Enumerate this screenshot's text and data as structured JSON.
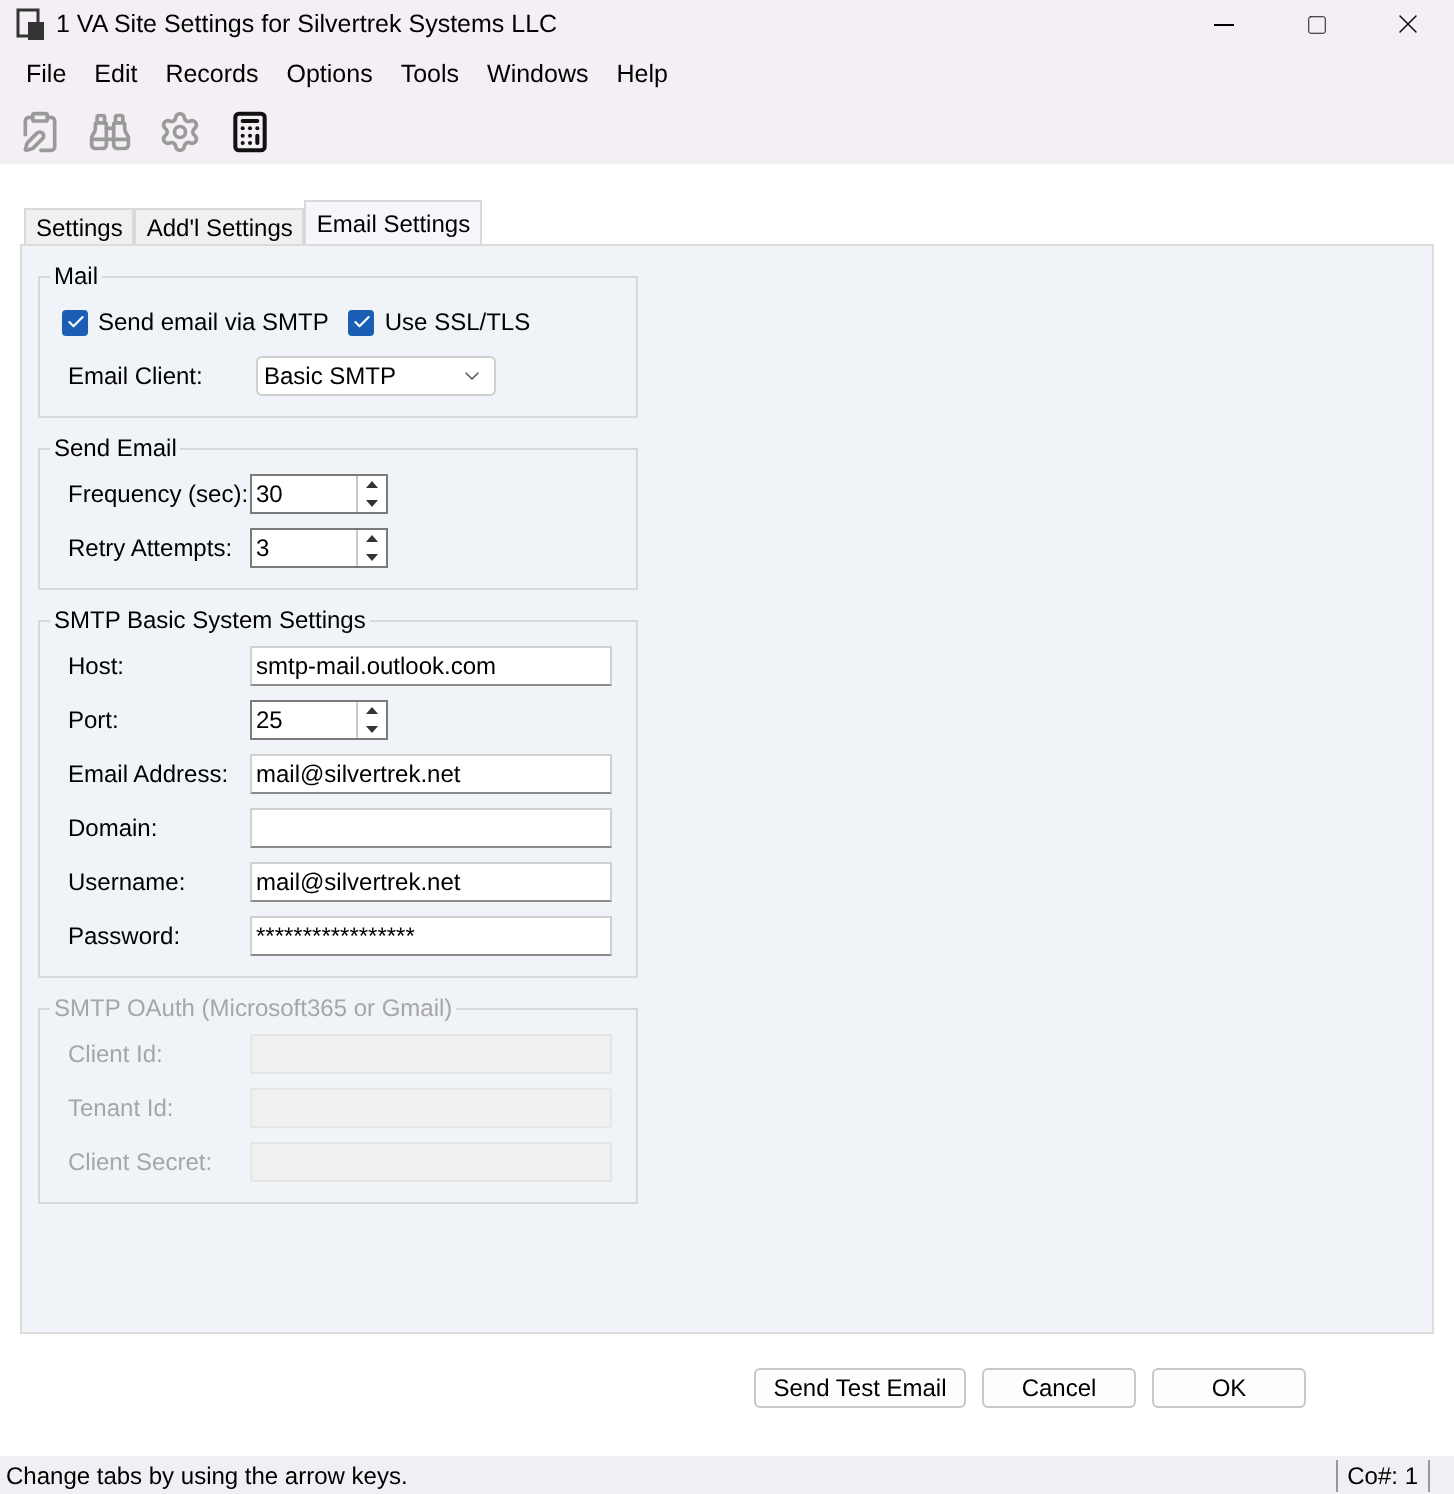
{
  "window": {
    "title": "1 VA Site Settings for Silvertrek Systems LLC"
  },
  "menu": [
    "File",
    "Edit",
    "Records",
    "Options",
    "Tools",
    "Windows",
    "Help"
  ],
  "toolbar": [
    {
      "kind": "clipboard",
      "disabled": true
    },
    {
      "kind": "binoculars",
      "disabled": true
    },
    {
      "kind": "gear",
      "disabled": true
    },
    {
      "kind": "calculator",
      "disabled": false
    }
  ],
  "tabs": [
    {
      "label": "Settings",
      "selected": false
    },
    {
      "label": "Add'l Settings",
      "selected": false
    },
    {
      "label": "Email Settings",
      "selected": true
    }
  ],
  "groups": [
    {
      "title": "Mail",
      "disabled": false,
      "checkboxes": [
        {
          "label": "Send email via SMTP",
          "checked": true
        },
        {
          "label": "Use SSL/TLS",
          "checked": true
        }
      ],
      "fields": [
        {
          "label": "Email Client:",
          "kind": "select",
          "value": "Basic SMTP"
        }
      ]
    },
    {
      "title": "Send Email",
      "disabled": false,
      "fields": [
        {
          "label": "Frequency (sec):",
          "kind": "spin",
          "value": "30"
        },
        {
          "label": "Retry Attempts:",
          "kind": "spin",
          "value": "3"
        }
      ]
    },
    {
      "title": "SMTP Basic System Settings",
      "disabled": false,
      "fields": [
        {
          "label": "Host:",
          "kind": "text",
          "value": "smtp-mail.outlook.com"
        },
        {
          "label": "Port:",
          "kind": "spin",
          "value": "25"
        },
        {
          "label": "Email Address:",
          "kind": "text",
          "value": "mail@silvertrek.net"
        },
        {
          "label": "Domain:",
          "kind": "text"
        },
        {
          "label": "Username:",
          "kind": "text",
          "value": "mail@silvertrek.net"
        },
        {
          "label": "Password:",
          "kind": "text",
          "value": "*****************"
        }
      ]
    },
    {
      "title": "SMTP OAuth (Microsoft365 or Gmail)",
      "disabled": true,
      "fields": [
        {
          "label": "Client Id:",
          "kind": "text"
        },
        {
          "label": "Tenant Id:",
          "kind": "text"
        },
        {
          "label": "Client Secret:",
          "kind": "text"
        }
      ]
    }
  ],
  "buttons": [
    "Send Test Email",
    "Cancel",
    "OK"
  ],
  "status_bar": {
    "message": "Change tabs by using the arrow keys.",
    "company": "Co#: 1"
  }
}
